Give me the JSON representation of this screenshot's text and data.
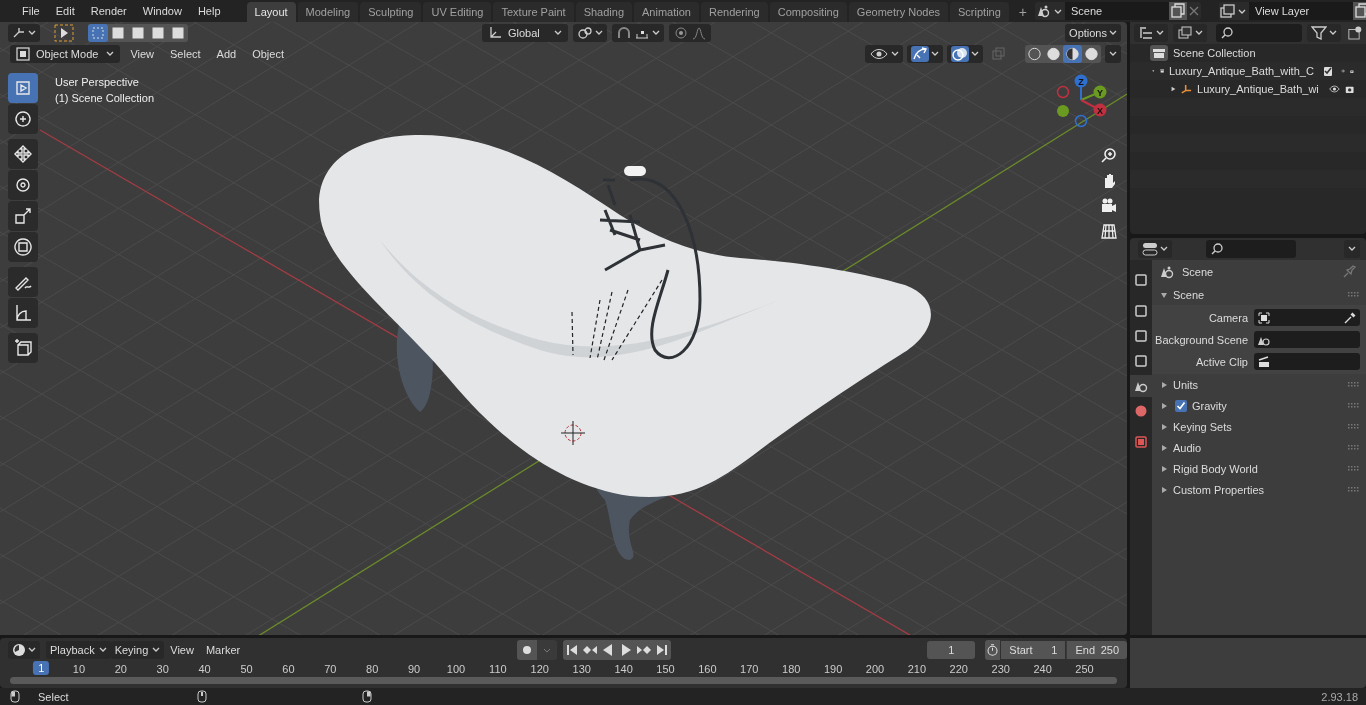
{
  "menu": [
    "File",
    "Edit",
    "Render",
    "Window",
    "Help"
  ],
  "workspaces": [
    {
      "label": "Layout",
      "selected": true
    },
    {
      "label": "Modeling",
      "selected": false
    },
    {
      "label": "Sculpting",
      "selected": false
    },
    {
      "label": "UV Editing",
      "selected": false
    },
    {
      "label": "Texture Paint",
      "selected": false
    },
    {
      "label": "Shading",
      "selected": false
    },
    {
      "label": "Animation",
      "selected": false
    },
    {
      "label": "Rendering",
      "selected": false
    },
    {
      "label": "Compositing",
      "selected": false
    },
    {
      "label": "Geometry Nodes",
      "selected": false
    },
    {
      "label": "Scripting",
      "selected": false
    }
  ],
  "add_workspace": "+",
  "scene": "Scene",
  "view_layer": "View Layer",
  "viewport": {
    "orientation": "Global",
    "options": "Options",
    "mode": "Object Mode",
    "menus": [
      "View",
      "Select",
      "Add",
      "Object"
    ],
    "info": [
      "User Perspective",
      "(1) Scene Collection"
    ],
    "select_modes": [
      {
        "selected": true
      },
      {
        "selected": false
      },
      {
        "selected": false
      },
      {
        "selected": false
      },
      {
        "selected": false
      }
    ],
    "tools": [
      {
        "selected": true
      },
      {
        "selected": false
      },
      {
        "selected": false
      },
      {
        "selected": false
      },
      {
        "selected": false
      },
      {
        "selected": false
      },
      {
        "selected": false
      },
      {
        "selected": false
      },
      {
        "selected": false
      }
    ],
    "shading": [
      {
        "selected": false
      },
      {
        "selected": false
      },
      {
        "selected": true
      },
      {
        "selected": false
      }
    ],
    "gizmo_axes": [
      "Z",
      "Y",
      "X"
    ],
    "gizmos_on": true,
    "overlays_on": true
  },
  "outliner": {
    "root": "Scene Collection",
    "items": [
      {
        "label": "Luxury_Antique_Bath_with_C",
        "kind": "collection",
        "expanded": true,
        "checked": true,
        "children": [
          {
            "label": "Luxury_Antique_Bath_wi",
            "kind": "object",
            "expanded": false
          }
        ]
      }
    ]
  },
  "properties": {
    "tabs": [
      {
        "selected": false
      },
      {
        "selected": false
      },
      {
        "selected": false
      },
      {
        "selected": false
      },
      {
        "selected": true
      },
      {
        "selected": false
      },
      {
        "selected": false
      }
    ],
    "context": "Scene",
    "panels": [
      {
        "label": "Scene",
        "expanded": true,
        "fields": [
          {
            "label": "Camera",
            "kind": "camera"
          },
          {
            "label": "Background Scene",
            "kind": "scene"
          },
          {
            "label": "Active Clip",
            "kind": "clip"
          }
        ]
      },
      {
        "label": "Units",
        "expanded": false
      },
      {
        "label": "Gravity",
        "expanded": false,
        "checked": true
      },
      {
        "label": "Keying Sets",
        "expanded": false
      },
      {
        "label": "Audio",
        "expanded": false
      },
      {
        "label": "Rigid Body World",
        "expanded": false
      },
      {
        "label": "Custom Properties",
        "expanded": false
      }
    ]
  },
  "timeline": {
    "menus": [
      "Playback",
      "Keying",
      "View",
      "Marker"
    ],
    "auto_key": false,
    "current_frame": "1",
    "start_label": "Start",
    "start": "1",
    "end_label": "End",
    "end": "250",
    "ruler": [
      "1",
      "10",
      "20",
      "30",
      "40",
      "50",
      "60",
      "70",
      "80",
      "90",
      "100",
      "110",
      "120",
      "130",
      "140",
      "150",
      "160",
      "170",
      "180",
      "190",
      "200",
      "210",
      "220",
      "230",
      "240",
      "250"
    ]
  },
  "status": {
    "left": "Select",
    "version": "2.93.18"
  }
}
